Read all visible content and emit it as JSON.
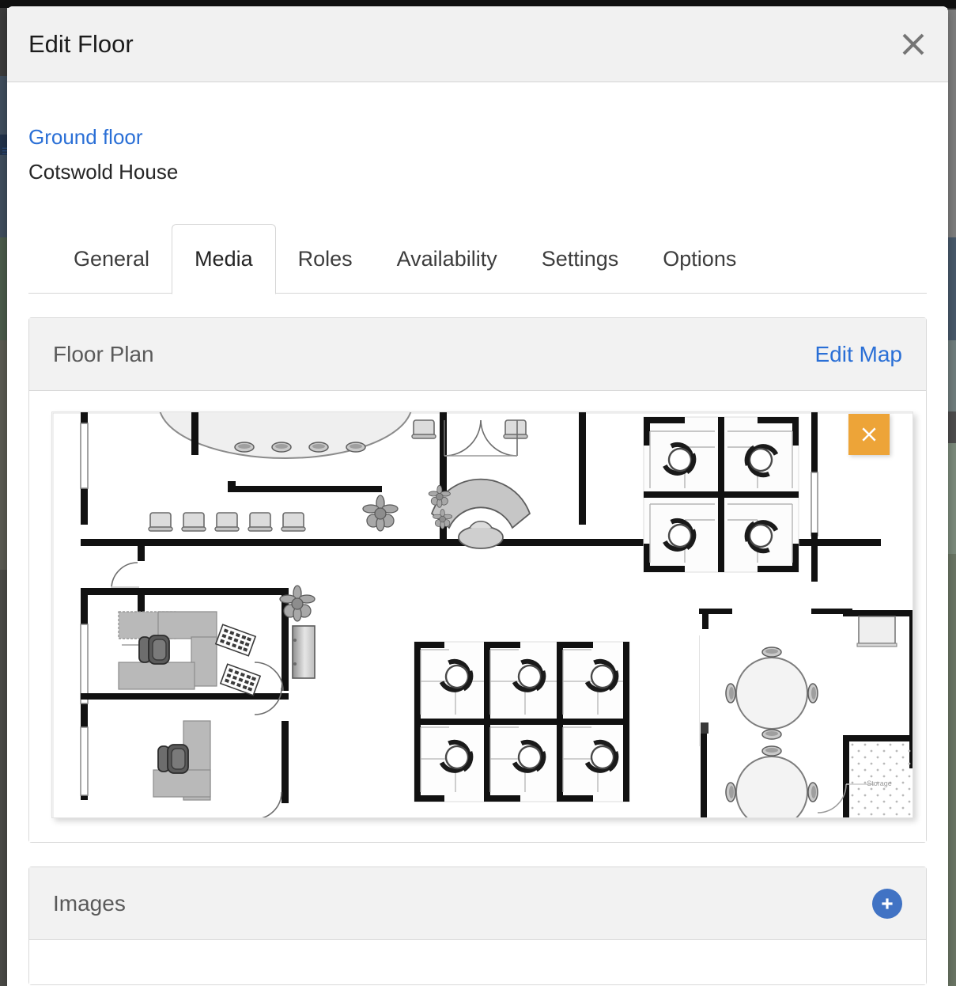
{
  "modal": {
    "title": "Edit Floor",
    "close_icon": "close-icon"
  },
  "breadcrumb": {
    "floor_link": "Ground floor",
    "building_name": "Cotswold House"
  },
  "tabs": [
    {
      "label": "General",
      "active": false
    },
    {
      "label": "Media",
      "active": true
    },
    {
      "label": "Roles",
      "active": false
    },
    {
      "label": "Availability",
      "active": false
    },
    {
      "label": "Settings",
      "active": false
    },
    {
      "label": "Options",
      "active": false
    }
  ],
  "floor_plan_panel": {
    "title": "Floor Plan",
    "edit_map_label": "Edit Map",
    "delete_icon": "close-x-icon",
    "delete_color": "#eda438",
    "map": {
      "storage_label": "Storage"
    }
  },
  "images_panel": {
    "title": "Images",
    "add_icon": "plus-icon",
    "add_color": "#4173c4"
  },
  "colors": {
    "link": "#2a6fd6",
    "panel_header_bg": "#f2f2f2",
    "modal_header_bg": "#f1f1f1",
    "accent_warning": "#eda438",
    "accent_primary": "#4173c4"
  }
}
